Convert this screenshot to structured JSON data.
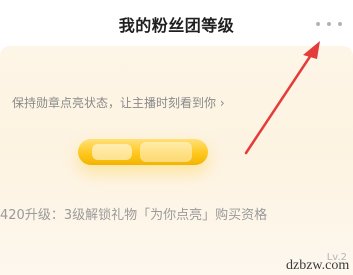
{
  "header": {
    "title": "我的粉丝团等级",
    "more_icon": "more-dots-icon"
  },
  "card": {
    "hint": "保持勋章点亮状态，让主播时刻看到你 ›",
    "upgrade_text": "420升级：3级解锁礼物「为你点亮」购买资格",
    "level_tag": "Lv.2"
  },
  "annotation": {
    "arrow_color": "#e43b3b",
    "watermark": "dzbzw.com"
  },
  "colors": {
    "badge_yellow": "#ffc81e",
    "card_bg": "#fdf5e7"
  }
}
